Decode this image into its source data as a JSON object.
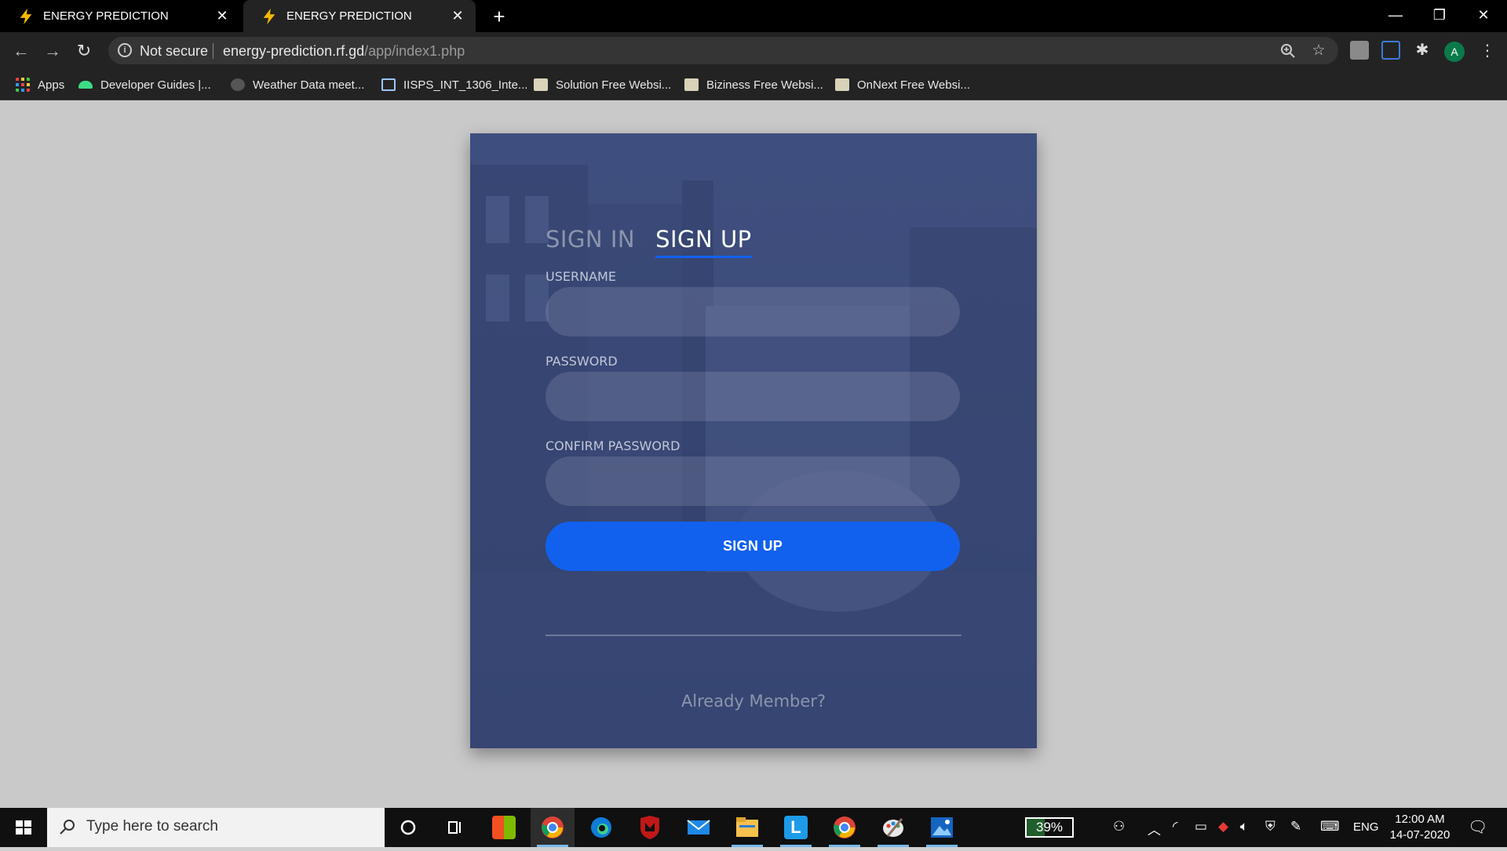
{
  "browser": {
    "tabs": [
      {
        "title": "ENERGY PREDICTION",
        "active": false
      },
      {
        "title": "ENERGY PREDICTION",
        "active": true
      }
    ],
    "security_label": "Not secure",
    "url_host": "energy-prediction.rf.gd",
    "url_path": "/app/index1.php",
    "profile_initial": "A",
    "bookmarks": [
      {
        "label": "Apps",
        "icon": "apps-grid-icon"
      },
      {
        "label": "Developer Guides |...",
        "icon": "android-icon"
      },
      {
        "label": "Weather Data meet...",
        "icon": "weather-site-icon"
      },
      {
        "label": "IISPS_INT_1306_Inte...",
        "icon": "document-icon"
      },
      {
        "label": "Solution Free Websi...",
        "icon": "site-thumbnail-icon"
      },
      {
        "label": "Biziness Free Websi...",
        "icon": "site-thumbnail-icon"
      },
      {
        "label": "OnNext Free Websi...",
        "icon": "site-thumbnail-icon"
      }
    ]
  },
  "form": {
    "tab_signin": "SIGN IN",
    "tab_signup": "SIGN UP",
    "username_label": "USERNAME",
    "username_value": "",
    "password_label": "PASSWORD",
    "password_value": "",
    "confirm_label": "CONFIRM PASSWORD",
    "confirm_value": "",
    "submit_label": "SIGN UP",
    "footer_link": "Already Member?",
    "accent_color": "#1161ee"
  },
  "taskbar": {
    "search_placeholder": "Type here to search",
    "battery": "39%",
    "battery_level": 0.39,
    "language": "ENG",
    "time": "12:00 AM",
    "date": "14-07-2020"
  }
}
